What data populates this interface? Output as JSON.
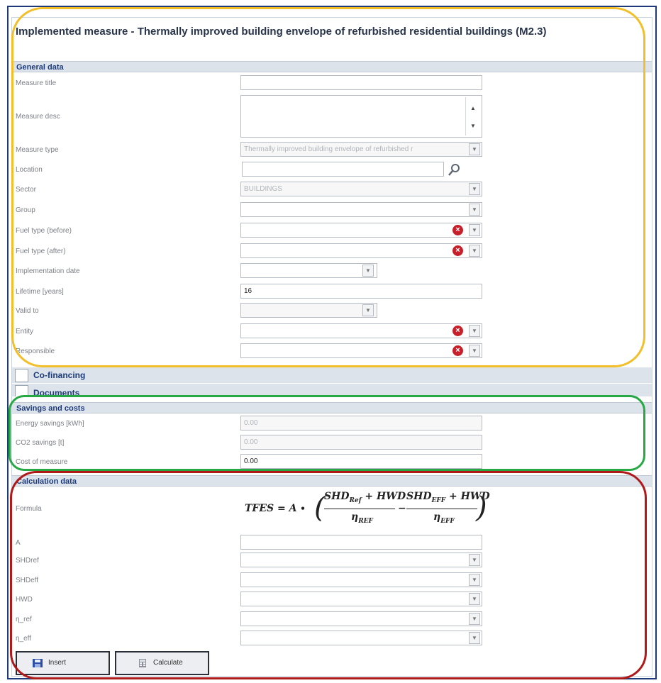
{
  "title": "Implemented measure - Thermally improved building envelope of refurbished residential buildings (M2.3)",
  "sections": {
    "general": "General data",
    "savings": "Savings and costs",
    "calc": "Calculation data"
  },
  "general": {
    "measure_title_label": "Measure title",
    "measure_desc_label": "Measure desc",
    "measure_type_label": "Measure type",
    "measure_type_value": "Thermally improved building envelope of refurbished r",
    "location_label": "Location",
    "sector_label": "Sector",
    "sector_value": "BUILDINGS",
    "group_label": "Group",
    "fuel_before_label": "Fuel type (before)",
    "fuel_after_label": "Fuel type (after)",
    "impl_date_label": "Implementation date",
    "lifetime_label": "Lifetime [years]",
    "lifetime_value": "16",
    "valid_to_label": "Valid to",
    "entity_label": "Entity",
    "responsible_label": "Responsible"
  },
  "expanders": {
    "cofinancing": "Co-financing",
    "documents": "Documents"
  },
  "savings": {
    "energy_label": "Energy savings [kWh]",
    "energy_value": "0.00",
    "co2_label": "CO2 savings [t]",
    "co2_value": "0.00",
    "cost_label": "Cost of measure",
    "cost_value": "0.00"
  },
  "calc": {
    "formula_label": "Formula",
    "formula_lhs": "TFES = A ∙",
    "formula_num1": "SHD",
    "formula_sub1": "Ref",
    "formula_num1_rest": " + HWD",
    "formula_den1": "η",
    "formula_den1_sub": "REF",
    "formula_minus": "−",
    "formula_num2": "SHD",
    "formula_sub2": "EFF",
    "formula_num2_rest": " + HWD",
    "formula_den2": "η",
    "formula_den2_sub": "EFF",
    "a_label": "A",
    "shdref_label": "SHDref",
    "shdeff_label": "SHDeff",
    "hwd_label": "HWD",
    "nref_label": "η_ref",
    "neff_label": "η_eff"
  },
  "buttons": {
    "insert": "Insert",
    "calculate": "Calculate"
  },
  "icons": {
    "search": "search-icon",
    "clear": "clear-icon",
    "dropdown": "chevron-down-icon"
  },
  "colors": {
    "outline_general": "#f2bf2a",
    "outline_savings": "#27a845",
    "outline_calc": "#b01919",
    "header_text": "#1d3b7a"
  }
}
